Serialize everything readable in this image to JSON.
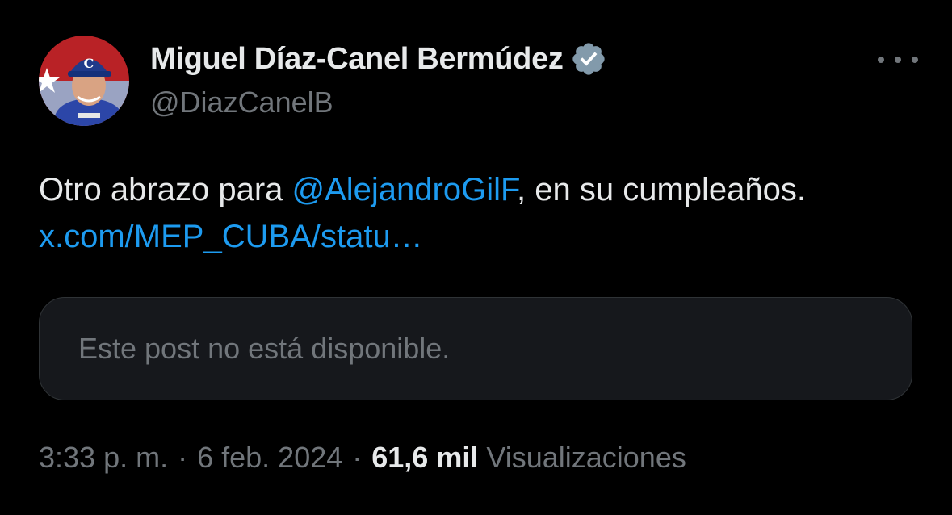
{
  "author": {
    "display_name": "Miguel Díaz-Canel Bermúdez",
    "handle": "@DiazCanelB",
    "verified_badge": "verified-badge-icon"
  },
  "tweet": {
    "text_before": "Otro abrazo para ",
    "mention": "@AlejandroGilF",
    "text_middle": ", en su cumpleaños. ",
    "link": "x.com/MEP_CUBA/statu…"
  },
  "quote": {
    "unavailable_text": "Este post no está disponible."
  },
  "meta": {
    "time": "3:33 p. m.",
    "date": "6 feb. 2024",
    "separator": "·",
    "views_count": "61,6 mil",
    "views_label": "Visualizaciones"
  },
  "colors": {
    "background": "#000000",
    "text": "#e7e9ea",
    "secondary": "#71767b",
    "link": "#1d9bf0",
    "card_border": "#2f3336"
  }
}
